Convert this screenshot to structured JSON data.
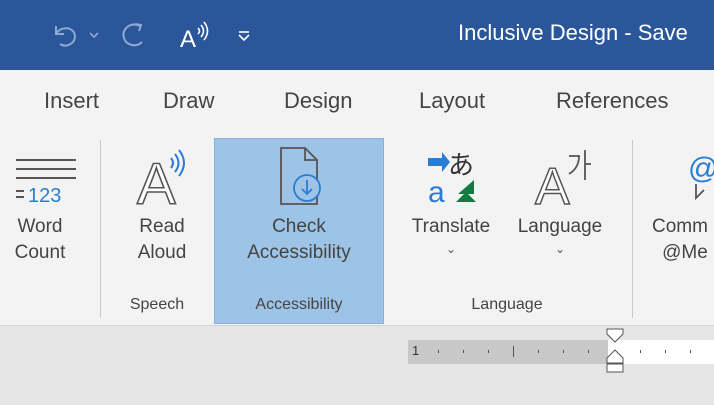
{
  "titlebar": {
    "title": "Inclusive Design  -  Save",
    "background": "#2b579a",
    "quick_access": [
      {
        "name": "undo-icon"
      },
      {
        "name": "undo-dropdown-icon"
      },
      {
        "name": "redo-icon"
      },
      {
        "name": "read-aloud-qat-icon"
      },
      {
        "name": "customize-qat-icon"
      }
    ]
  },
  "tabs": [
    "Insert",
    "Draw",
    "Design",
    "Layout",
    "References"
  ],
  "ribbon": {
    "word_count": {
      "line1": "Word",
      "line2": "Count"
    },
    "read_aloud": {
      "line1": "Read",
      "line2": "Aloud"
    },
    "check_accessibility": {
      "line1": "Check",
      "line2": "Accessibility"
    },
    "translate": {
      "line1": "Translate",
      "chevron": "⌄"
    },
    "language": {
      "line1": "Language",
      "chevron": "⌄"
    },
    "comments": {
      "line1": "Comm",
      "line2": "@Me"
    },
    "groups": {
      "speech": "Speech",
      "accessibility": "Accessibility",
      "language": "Language"
    },
    "highlight_color": "#9dc3e6"
  },
  "ruler": {
    "number": "1"
  },
  "icons": {
    "word_count_digits": "123"
  }
}
